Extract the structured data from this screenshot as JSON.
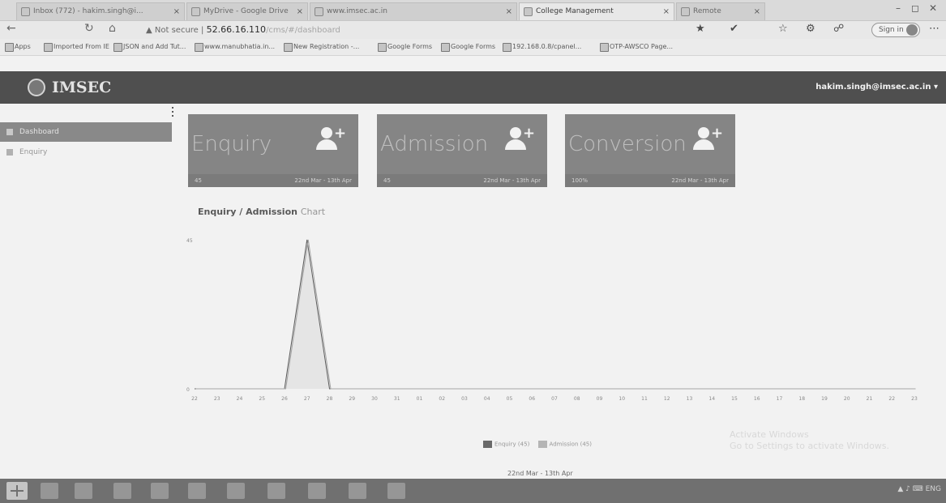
{
  "browser": {
    "tabs": [
      {
        "title": "Inbox (772) - hakim.singh@i...",
        "active": false
      },
      {
        "title": "MyDrive - Google Drive",
        "active": false
      },
      {
        "title": "www.imsec.ac.in",
        "active": false
      },
      {
        "title": "College Management",
        "active": true
      },
      {
        "title": "Remote",
        "active": false
      }
    ],
    "url_security": "Not secure",
    "url_host": "52.66.16.110",
    "url_path": "/cms/#/dashboard",
    "signin_label": "Sign in",
    "bookmarks": [
      "Apps",
      "Imported From IE",
      "JSON and Add Tut...",
      "www.manubhatia.in...",
      "New Registration -...",
      "Google Forms",
      "Google Forms",
      "192.168.0.8/cpanel...",
      "OTP-AWSCO Page..."
    ]
  },
  "app": {
    "logo_text": "IMSEC",
    "user_email": "hakim.singh@imsec.ac.in"
  },
  "sidebar": {
    "items": [
      {
        "label": "Dashboard",
        "active": true
      },
      {
        "label": "Enquiry",
        "active": false
      }
    ]
  },
  "cards": [
    {
      "title": "Enquiry",
      "value": "45",
      "range": "22nd Mar - 13th Apr"
    },
    {
      "title": "Admission",
      "value": "45",
      "range": "22nd Mar - 13th Apr"
    },
    {
      "title": "Conversion",
      "value": "100%",
      "range": "22nd Mar - 13th Apr"
    }
  ],
  "chart_title_bold": "Enquiry / Admission",
  "chart_title_light": "Chart",
  "chart_data": {
    "type": "line",
    "x": [
      "22",
      "23",
      "24",
      "25",
      "26",
      "27",
      "28",
      "29",
      "30",
      "31",
      "01",
      "02",
      "03",
      "04",
      "05",
      "06",
      "07",
      "08",
      "09",
      "10",
      "11",
      "12",
      "13",
      "14",
      "15",
      "16",
      "17",
      "18",
      "19",
      "20",
      "21",
      "22",
      "23"
    ],
    "series": [
      {
        "name": "Enquiry",
        "values": [
          0,
          0,
          0,
          0,
          0,
          45,
          0,
          0,
          0,
          0,
          0,
          0,
          0,
          0,
          0,
          0,
          0,
          0,
          0,
          0,
          0,
          0,
          0,
          0,
          0,
          0,
          0,
          0,
          0,
          0,
          0,
          0,
          0
        ]
      },
      {
        "name": "Admission",
        "values": [
          0,
          0,
          0,
          0,
          0,
          45,
          0,
          0,
          0,
          0,
          0,
          0,
          0,
          0,
          0,
          0,
          0,
          0,
          0,
          0,
          0,
          0,
          0,
          0,
          0,
          0,
          0,
          0,
          0,
          0,
          0,
          0,
          0
        ]
      }
    ],
    "ylim": [
      0,
      45
    ],
    "legend": "bottom",
    "grid": false
  },
  "legend": {
    "enquiry": "Enquiry (45)",
    "admission": "Admission (45)"
  },
  "footer_range": "22nd Mar - 13th Apr",
  "watermark_line1": "Activate Windows",
  "watermark_line2": "Go to Settings to activate Windows."
}
